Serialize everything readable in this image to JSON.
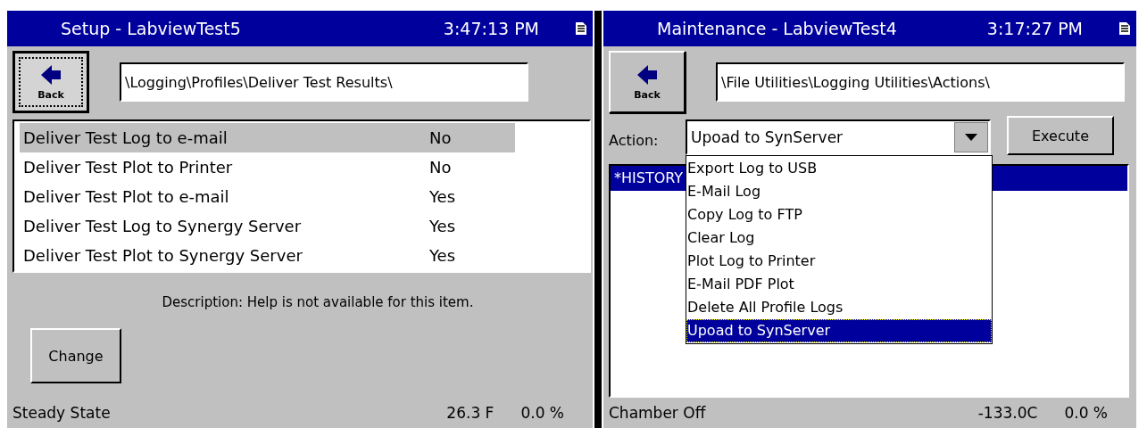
{
  "panels": [
    {
      "kind": "setup",
      "title": "Setup - LabviewTest5",
      "time": "3:47:13 PM",
      "back_label": "Back",
      "back_focused": true,
      "path": "\\Logging\\Profiles\\Deliver Test Results\\",
      "settings": [
        {
          "name": "Deliver Test Log to e-mail",
          "value": "No",
          "selected": true
        },
        {
          "name": "Deliver Test Plot to Printer",
          "value": "No",
          "selected": false
        },
        {
          "name": "Deliver Test Plot to e-mail",
          "value": "Yes",
          "selected": false
        },
        {
          "name": "Deliver Test Log to Synergy Server",
          "value": "Yes",
          "selected": false
        },
        {
          "name": "Deliver Test Plot to Synergy Server",
          "value": "Yes",
          "selected": false
        }
      ],
      "description": "Description:  Help is not available for this item.",
      "button": "Change",
      "status": {
        "state": "Steady State",
        "temperature": "26.3 F",
        "output": "0.0 %"
      }
    },
    {
      "kind": "maintenance",
      "title": "Maintenance - LabviewTest4",
      "time": "3:17:27 PM",
      "back_label": "Back",
      "back_focused": false,
      "path": "\\File Utilities\\Logging Utilities\\Actions\\",
      "action": {
        "label": "Action:",
        "value": "Upoad to SynServer",
        "expanded": true,
        "options": [
          {
            "label": "Export Log to USB",
            "selected": false
          },
          {
            "label": "E-Mail Log",
            "selected": false
          },
          {
            "label": "Copy Log to FTP",
            "selected": false
          },
          {
            "label": "Clear Log",
            "selected": false
          },
          {
            "label": "Plot Log to Printer",
            "selected": false
          },
          {
            "label": "E-Mail PDF Plot",
            "selected": false
          },
          {
            "label": "Delete All Profile Logs",
            "selected": false
          },
          {
            "label": "Upoad to SynServer",
            "selected": true
          }
        ]
      },
      "button": "Execute",
      "logs": [
        {
          "name": "*HISTORY",
          "selected": true
        }
      ],
      "status": {
        "state": "Chamber Off",
        "temperature": "-133.0C",
        "output": "0.0 %"
      }
    }
  ]
}
